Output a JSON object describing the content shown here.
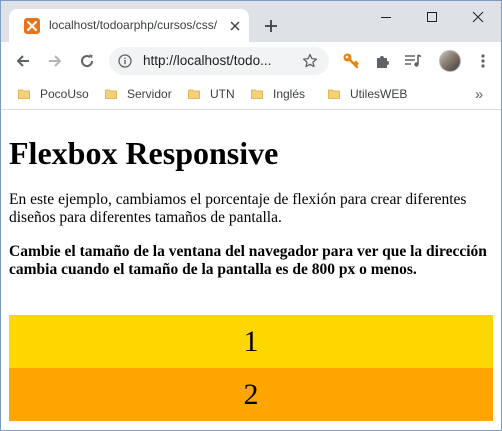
{
  "tab": {
    "title": "localhost/todoarphp/cursos/css/"
  },
  "omnibox": {
    "url": "http://localhost/todo..."
  },
  "bookmarks": {
    "items": [
      {
        "label": "PocoUso"
      },
      {
        "label": "Servidor"
      },
      {
        "label": "UTN"
      },
      {
        "label": "Inglés"
      },
      {
        "label": "UtilesWEB"
      }
    ],
    "more": "»"
  },
  "page": {
    "title": "Flexbox Responsive",
    "description": "En este ejemplo, cambiamos el porcentaje de flexión para crear diferentes diseños para diferentes tamaños de pantalla.",
    "note": "Cambie el tamaño de la ventana del navegador para ver que la dirección cambia cuando el tamaño de la pantalla es de 800 px o menos.",
    "flex_items": [
      {
        "label": "1",
        "color": "#ffd700"
      },
      {
        "label": "2",
        "color": "#ffa500"
      }
    ]
  },
  "colors": {
    "tabstrip_bg": "#dee1e6",
    "favicon": "#e8731a",
    "extension_key": "#e8850e",
    "folder": "#f5d27a"
  },
  "icons": {
    "back": "back-arrow-icon",
    "forward": "forward-arrow-icon",
    "reload": "reload-icon",
    "info": "info-icon",
    "star": "star-icon",
    "key": "key-icon",
    "extensions": "puzzle-icon",
    "media": "media-queue-icon",
    "new_tab": "plus-icon",
    "close_tab": "close-icon"
  }
}
